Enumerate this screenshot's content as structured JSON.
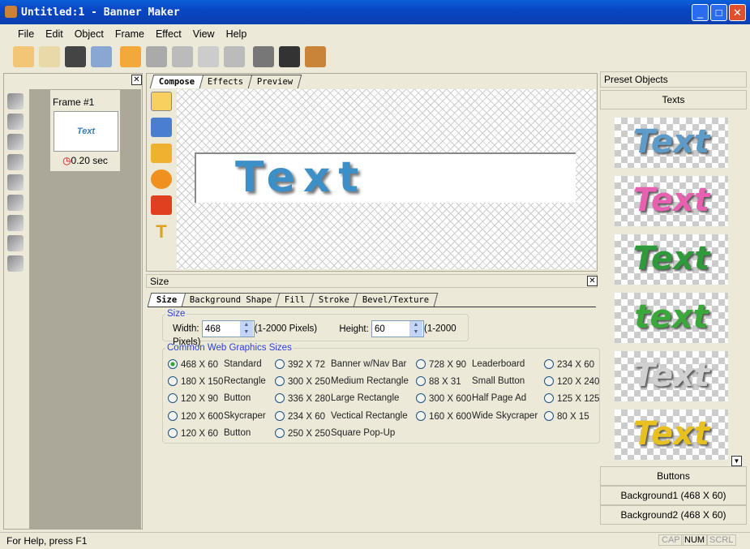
{
  "window": {
    "title": "Untitled:1 - Banner Maker",
    "min": "_",
    "max": "□",
    "close": "✕"
  },
  "menu": [
    "File",
    "Edit",
    "Object",
    "Frame",
    "Effect",
    "View",
    "Help"
  ],
  "toolbar": [
    {
      "icon": "new-icon",
      "color": "#f3c577"
    },
    {
      "icon": "open-icon",
      "color": "#e9d9a8"
    },
    {
      "icon": "save-icon",
      "color": "#444"
    },
    {
      "icon": "print-icon",
      "color": "#8aa7d4"
    },
    {
      "icon": "undo-icon",
      "color": "#f2a93a"
    },
    {
      "icon": "redo-icon",
      "color": "#aaa"
    },
    {
      "icon": "cut-icon",
      "color": "#bbb"
    },
    {
      "icon": "copy-icon",
      "color": "#ccc"
    },
    {
      "icon": "paste-icon",
      "color": "#bbb"
    },
    {
      "icon": "delete-icon",
      "color": "#777"
    },
    {
      "icon": "cube-icon",
      "color": "#333"
    },
    {
      "icon": "effect-icon",
      "color": "#c9843a"
    }
  ],
  "left": {
    "frame_label": "Frame #1",
    "thumb_text": "Text",
    "duration": "0.20 sec"
  },
  "center": {
    "tabs": [
      "Compose",
      "Effects",
      "Preview"
    ],
    "banner_text": "Text"
  },
  "size_panel": {
    "title": "Size",
    "tabs": [
      "Size",
      "Background Shape",
      "Fill",
      "Stroke",
      "Bevel/Texture"
    ],
    "size_group": "Size",
    "width_label": "Width:",
    "width": "468",
    "width_range": "(1-2000 Pixels)",
    "height_label": "Height:",
    "height": "60",
    "height_range": "(1-2000 Pixels)",
    "common_group": "Common Web Graphics Sizes",
    "columns": [
      [
        {
          "size": "468 X 60",
          "desc": "Standard",
          "checked": true
        },
        {
          "size": "180 X 150",
          "desc": "Rectangle"
        },
        {
          "size": "120 X 90",
          "desc": "Button"
        },
        {
          "size": "120 X 600",
          "desc": "Skycraper"
        },
        {
          "size": "120 X 60",
          "desc": "Button"
        }
      ],
      [
        {
          "size": "392 X 72",
          "desc": "Banner w/Nav Bar"
        },
        {
          "size": "300 X 250",
          "desc": "Medium Rectangle"
        },
        {
          "size": "336 X 280",
          "desc": "Large Rectangle"
        },
        {
          "size": "234 X 60",
          "desc": "Vectical Rectangle"
        },
        {
          "size": "250 X 250",
          "desc": "Square Pop-Up"
        }
      ],
      [
        {
          "size": "728 X 90",
          "desc": "Leaderboard"
        },
        {
          "size": "88 X 31",
          "desc": "Small Button"
        },
        {
          "size": "300 X 600",
          "desc": "Half Page Ad"
        },
        {
          "size": "160 X 600",
          "desc": "Wide Skycraper"
        }
      ],
      [
        {
          "size": "234 X 60",
          "desc": ""
        },
        {
          "size": "120 X 240",
          "desc": ""
        },
        {
          "size": "125 X 125",
          "desc": ""
        },
        {
          "size": "80 X 15",
          "desc": ""
        }
      ]
    ]
  },
  "right": {
    "title": "Preset Objects",
    "section": "Texts",
    "presets": [
      {
        "text": "Text",
        "color": "#5d9bc9"
      },
      {
        "text": "Text",
        "color": "#e860b0"
      },
      {
        "text": "Text",
        "color": "#2e9a3a"
      },
      {
        "text": "text",
        "color": "#3aa83a"
      },
      {
        "text": "Text",
        "color": "#d0d0d0"
      },
      {
        "text": "Text",
        "color": "#e8c020"
      }
    ],
    "bottom": [
      "Buttons",
      "Background1 (468 X 60)",
      "Background2 (468 X 60)"
    ]
  },
  "status": {
    "text": "For Help, press F1",
    "indicators": [
      "CAP",
      "NUM",
      "SCRL"
    ]
  }
}
